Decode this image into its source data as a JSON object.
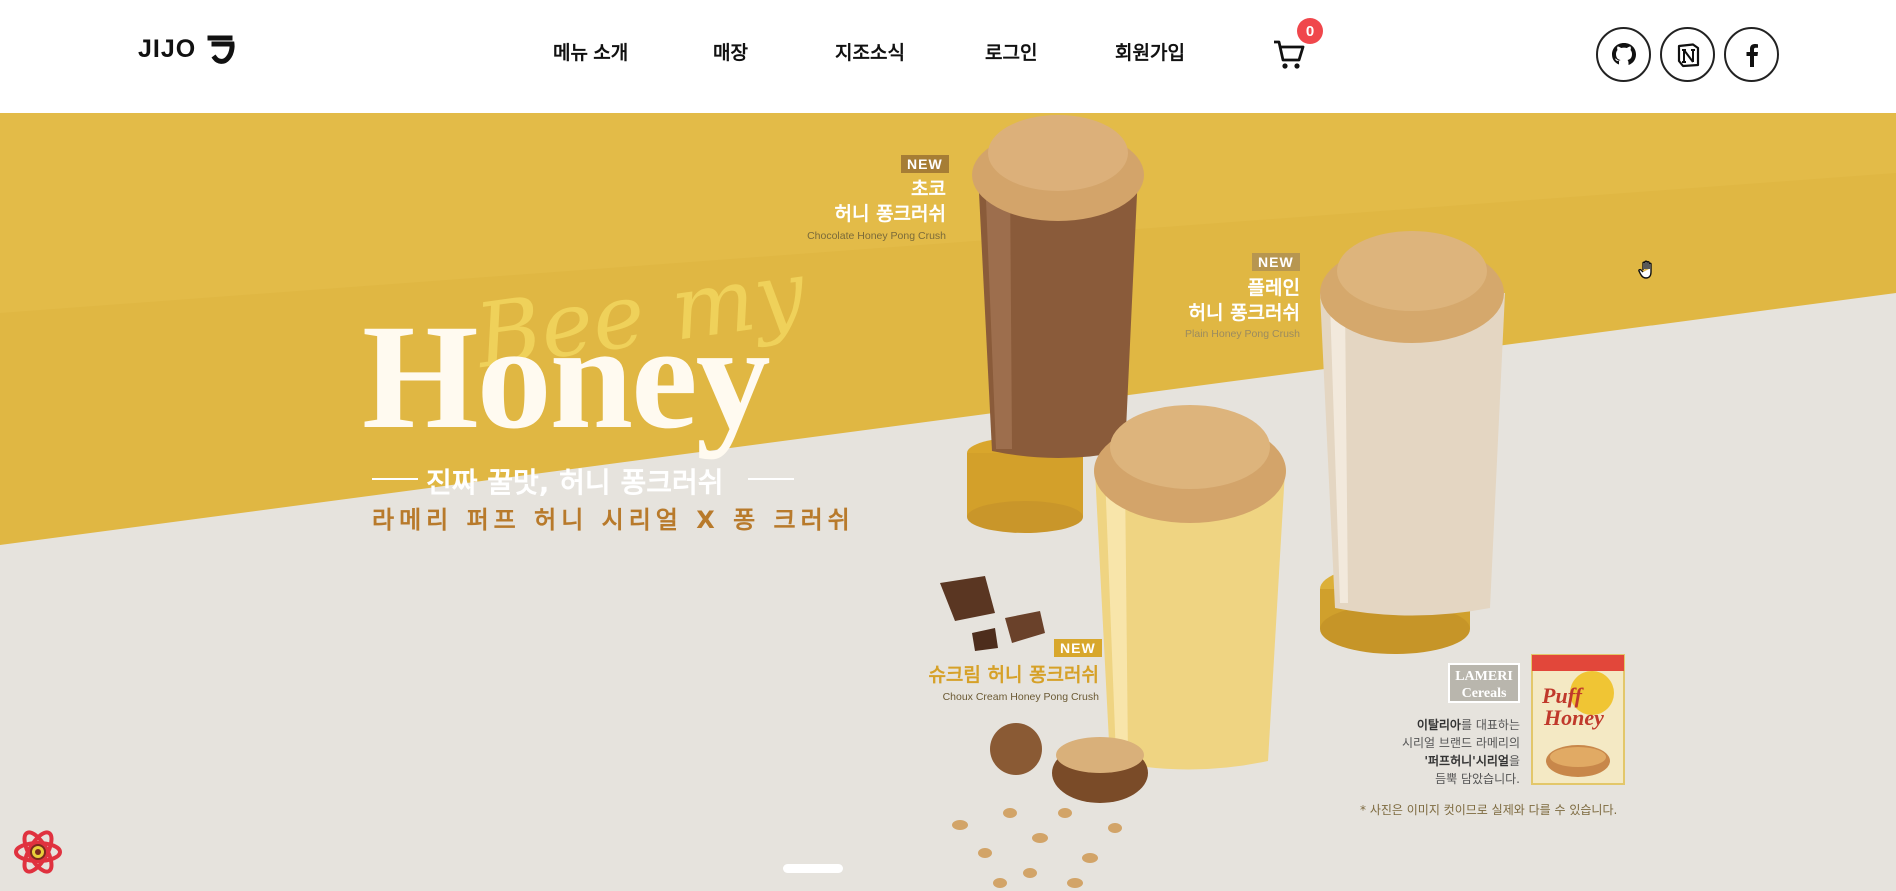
{
  "header": {
    "logo_text": "JIJO",
    "nav": [
      {
        "label": "메뉴 소개"
      },
      {
        "label": "매장"
      },
      {
        "label": "지조소식"
      },
      {
        "label": "로그인"
      },
      {
        "label": "회원가입"
      }
    ],
    "cart_count": "0",
    "social": [
      "github-icon",
      "notion-icon",
      "facebook-icon"
    ]
  },
  "hero": {
    "script_text": "Bee my",
    "title": "Honey",
    "tagline": "진짜 꿀맛, 허니 퐁크러쉬",
    "subline": "라메리 퍼프 허니 시리얼 X 퐁 크러쉬",
    "products": [
      {
        "badge": "NEW",
        "name_line1": "초코",
        "name_line2": "허니 퐁크러쉬",
        "name_en": "Chocolate Honey Pong Crush"
      },
      {
        "badge": "NEW",
        "name_line1": "플레인",
        "name_line2": "허니 퐁크러쉬",
        "name_en": "Plain Honey Pong Crush"
      },
      {
        "badge": "NEW",
        "name_line1": "슈크림 허니 퐁크러쉬",
        "name_en": "Choux Cream Honey Pong Crush"
      }
    ],
    "brand_logo_line1": "LAMERI",
    "brand_logo_line2": "Cereals",
    "box_text_line1": "Puff",
    "box_text_line2": "Honey",
    "desc_line1_bold": "이탈리아",
    "desc_line1_rest": "를 대표하는",
    "desc_line2": "시리얼 브랜드 라메리의",
    "desc_line3_bold": "'퍼프허니'시리얼",
    "desc_line3_rest": "을",
    "desc_line4": "듬뿍 담았습니다.",
    "disclaimer": "* 사진은 이미지 컷이므로 실제와 다를 수 있습니다."
  },
  "colors": {
    "mustard": "#e0b743",
    "floor": "#e6e3dd",
    "badge_dark": "#a67d35",
    "badge_gold": "#d8a72c",
    "cart_badge": "#f0474c"
  }
}
